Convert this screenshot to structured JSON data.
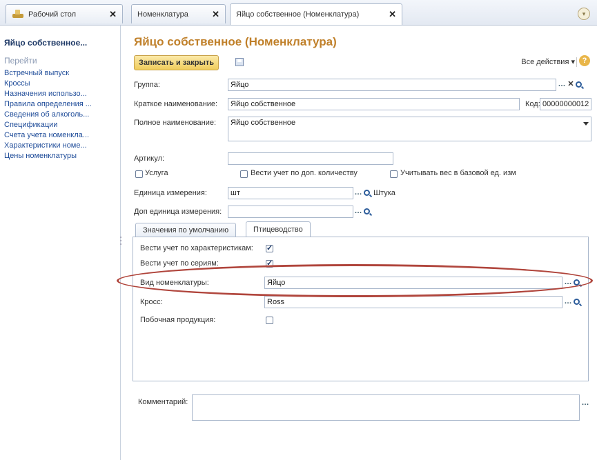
{
  "tabs": [
    {
      "label": "Рабочий стол"
    },
    {
      "label": "Номенклатура"
    },
    {
      "label": "Яйцо собственное (Номенклатура)"
    }
  ],
  "sidebar": {
    "title": "Яйцо собственное...",
    "section": "Перейти",
    "items": [
      {
        "label": "Встречный выпуск"
      },
      {
        "label": "Кроссы"
      },
      {
        "label": "Назначения использо..."
      },
      {
        "label": "Правила определения ..."
      },
      {
        "label": "Сведения об алкоголь..."
      },
      {
        "label": "Спецификации"
      },
      {
        "label": "Счета учета номенкла..."
      },
      {
        "label": "Характеристики номе..."
      },
      {
        "label": "Цены номенклатуры"
      }
    ]
  },
  "form": {
    "title": "Яйцо собственное (Номенклатура)",
    "save_label": "Записать и закрыть",
    "all_actions": "Все действия ▾",
    "group_label": "Группа:",
    "group_value": "Яйцо",
    "short_name_label": "Краткое наименование:",
    "short_name_value": "Яйцо собственное",
    "code_label": "Код:",
    "code_value": "00000000012",
    "full_name_label": "Полное наименование:",
    "full_name_value": "Яйцо собственное",
    "article_label": "Артикул:",
    "article_value": "",
    "service_label": "Услуга",
    "extra_qty_label": "Вести учет по доп. количеству",
    "weight_label": "Учитывать вес в базовой ед. изм",
    "unit_label": "Единица измерения:",
    "unit_value": "шт",
    "unit_name": "Штука",
    "extra_unit_label": "Доп единица измерения:",
    "extra_unit_value": "",
    "tab_defaults": "Значения по умолчанию",
    "tab_poultry": "Птицеводство",
    "chars_label": "Вести учет по характеристикам:",
    "series_label": "Вести учет по сериям:",
    "kind_label": "Вид номенклатуры:",
    "kind_value": "Яйцо",
    "cross_label": "Кросс:",
    "cross_value": "Ross",
    "byproduct_label": "Побочная продукция:",
    "comment_label": "Комментарий:",
    "comment_value": ""
  }
}
